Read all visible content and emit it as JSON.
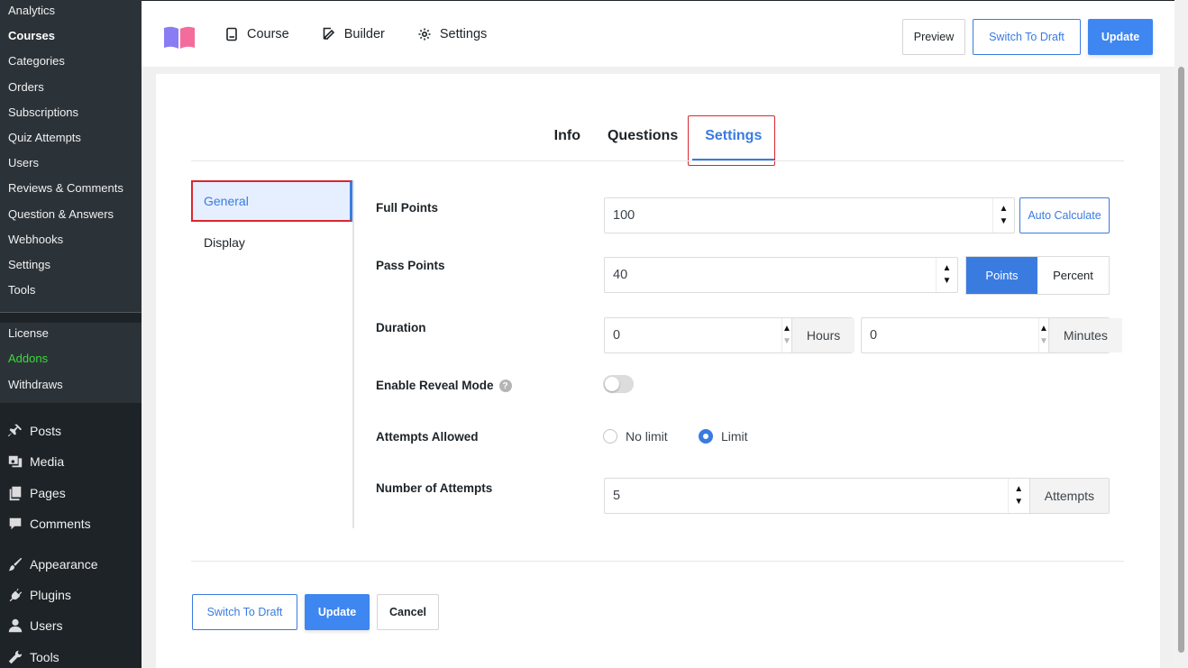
{
  "admin_sidebar": {
    "submenu": [
      {
        "label": "Analytics",
        "current": false
      },
      {
        "label": "Courses",
        "current": true
      },
      {
        "label": "Categories",
        "current": false
      },
      {
        "label": "Orders",
        "current": false
      },
      {
        "label": "Subscriptions",
        "current": false
      },
      {
        "label": "Quiz Attempts",
        "current": false
      },
      {
        "label": "Users",
        "current": false
      },
      {
        "label": "Reviews & Comments",
        "current": false
      },
      {
        "label": "Question & Answers",
        "current": false
      },
      {
        "label": "Webhooks",
        "current": false
      },
      {
        "label": "Settings",
        "current": false
      },
      {
        "label": "Tools",
        "current": false
      }
    ],
    "submenu2": [
      {
        "label": "License"
      },
      {
        "label": "Addons"
      },
      {
        "label": "Withdraws"
      }
    ],
    "main_menu": [
      {
        "label": "Posts",
        "icon": "pin-icon"
      },
      {
        "label": "Media",
        "icon": "media-icon"
      },
      {
        "label": "Pages",
        "icon": "pages-icon"
      },
      {
        "label": "Comments",
        "icon": "comment-icon"
      },
      {
        "label": "Appearance",
        "icon": "brush-icon"
      },
      {
        "label": "Plugins",
        "icon": "plug-icon"
      },
      {
        "label": "Users",
        "icon": "user-icon"
      },
      {
        "label": "Tools",
        "icon": "wrench-icon"
      }
    ]
  },
  "header": {
    "nav": [
      {
        "label": "Course",
        "icon": "book-icon"
      },
      {
        "label": "Builder",
        "icon": "edit-icon"
      },
      {
        "label": "Settings",
        "icon": "gear-icon"
      }
    ],
    "preview_label": "Preview",
    "switch_draft_label": "Switch To Draft",
    "update_label": "Update"
  },
  "tabs": [
    {
      "label": "Info",
      "active": false
    },
    {
      "label": "Questions",
      "active": false
    },
    {
      "label": "Settings",
      "active": true
    }
  ],
  "subnav": [
    {
      "label": "General",
      "active": true
    },
    {
      "label": "Display",
      "active": false
    }
  ],
  "form": {
    "full_points": {
      "label": "Full Points",
      "value": "100",
      "auto_label": "Auto Calculate"
    },
    "pass_points": {
      "label": "Pass Points",
      "value": "40",
      "unit_options": [
        "Points",
        "Percent"
      ],
      "selected_unit": "Points"
    },
    "duration": {
      "label": "Duration",
      "hours_value": "0",
      "hours_suffix": "Hours",
      "minutes_value": "0",
      "minutes_suffix": "Minutes"
    },
    "reveal_mode": {
      "label": "Enable Reveal Mode",
      "help": "?",
      "enabled": false
    },
    "attempts_allowed": {
      "label": "Attempts Allowed",
      "options": [
        "No limit",
        "Limit"
      ],
      "selected": "Limit"
    },
    "number_of_attempts": {
      "label": "Number of Attempts",
      "value": "5",
      "suffix": "Attempts"
    }
  },
  "footer": {
    "switch_draft_label": "Switch To Draft",
    "update_label": "Update",
    "cancel_label": "Cancel"
  },
  "colors": {
    "accent": "#3a7be0",
    "highlight_border": "#d9282f",
    "addons_green": "#3adb3a",
    "sidebar_bg": "#1d2327"
  }
}
